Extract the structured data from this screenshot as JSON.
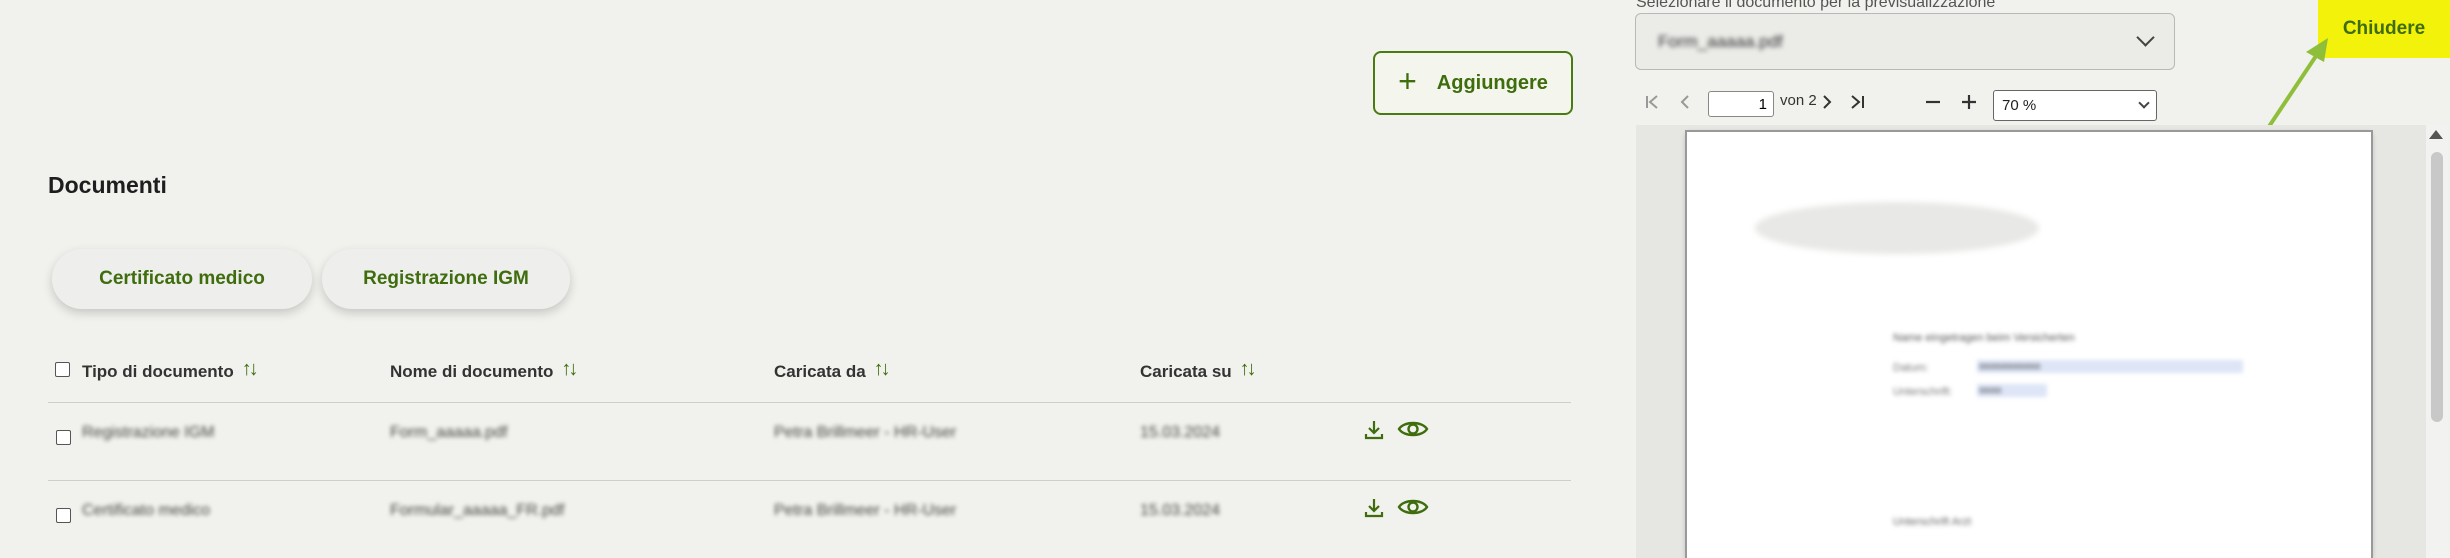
{
  "main": {
    "add_button": "Aggiungere",
    "section_title": "Documenti",
    "chips": [
      "Certificato medico",
      "Registrazione IGM"
    ],
    "columns": [
      "Tipo di documento",
      "Nome di documento",
      "Caricata da",
      "Caricata su"
    ],
    "rows": [
      {
        "type": "Registrazione IGM",
        "name": "Form_aaaaa.pdf",
        "uploaded_by": "Petra Brillmeer - HR-User",
        "uploaded_on": "15.03.2024"
      },
      {
        "type": "Certificato medico",
        "name": "Formular_aaaaa_FR.pdf",
        "uploaded_by": "Petra Brillmeer - HR-User",
        "uploaded_on": "15.03.2024"
      }
    ],
    "sort_glyph": "↑↓"
  },
  "preview": {
    "label": "Selezionare il documento per la previsualizzazione",
    "selected_document": "Form_aaaaa.pdf",
    "close_button": "Chiudere",
    "page_current": "1",
    "page_of": "von 2",
    "zoom": "70 %",
    "page_lines": {
      "heading": "Name eingetragen beim Versicherten",
      "field1_label": "Datum:",
      "field1_value": "aaaaaaaaaaa",
      "field2_label": "Unterschrift:",
      "field2_value": "aaaa",
      "footer": "Unterschrift Arzt"
    }
  },
  "colors": {
    "accent": "#3f6d0e",
    "highlight": "#f2f20a",
    "background": "#f1f1ed"
  },
  "icons": [
    "plus-icon",
    "download-icon",
    "eye-icon",
    "chevron-down-icon",
    "first-page-icon",
    "prev-page-icon",
    "next-page-icon",
    "last-page-icon",
    "zoom-out-icon",
    "zoom-in-icon"
  ]
}
